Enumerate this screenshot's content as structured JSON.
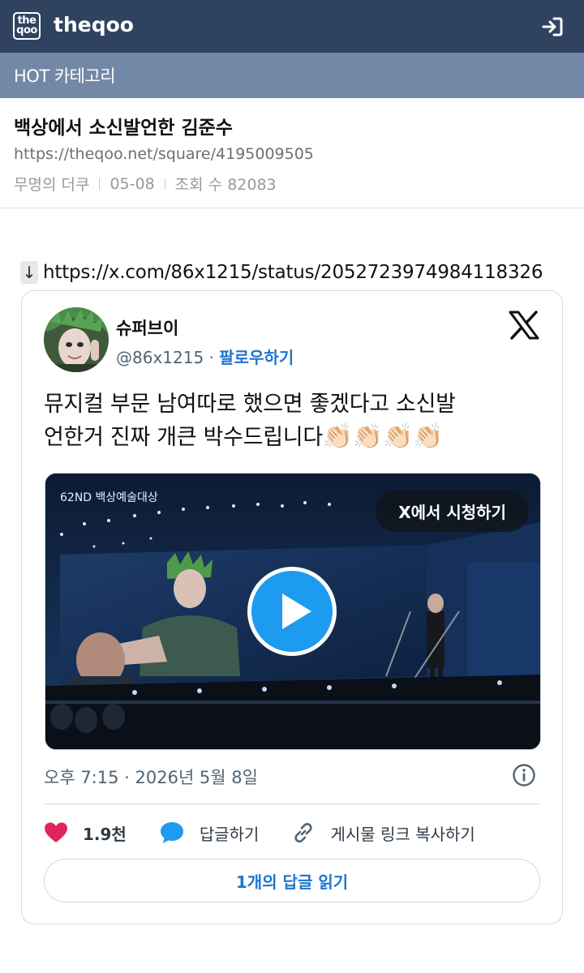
{
  "header": {
    "logo_top": "the",
    "logo_bottom": "qoo",
    "site_name": "theqoo"
  },
  "category_bar": {
    "label": "HOT 카테고리"
  },
  "post": {
    "title": "백상에서 소신발언한 김준수",
    "url": "https://theqoo.net/square/4195009505",
    "author": "무명의 더쿠",
    "date": "05-08",
    "views_label": "조회 수 82083"
  },
  "embed_link": {
    "arrow": "↓",
    "url": "https://x.com/86x1215/status/2052723974984118326"
  },
  "tweet": {
    "author_name": "슈퍼브이",
    "handle": "@86x1215",
    "dot": " · ",
    "follow_label": "팔로우하기",
    "text_line1": "뮤지컬 부문 남여따로 했으면 좋겠다고 소신발",
    "text_line2": "언한거 진짜 개큰 박수드립니다",
    "emoji": "👏🏻👏🏻👏🏻👏🏻",
    "watch_label": "X에서 시청하기",
    "video_overlay_text": "62ND 백상예술대상",
    "timestamp": "오후 7:15 · 2026년 5월 8일",
    "likes": "1.9천",
    "reply_label": "답글하기",
    "copy_link_label": "게시물 링크 복사하기",
    "read_replies_label": "1개의 답글 읽기"
  },
  "colors": {
    "topbar": "#2f4361",
    "catbar": "#7388a6",
    "link_blue": "#1d75cf",
    "like_pink": "#e0245e",
    "play_blue": "#1d9bf0"
  }
}
